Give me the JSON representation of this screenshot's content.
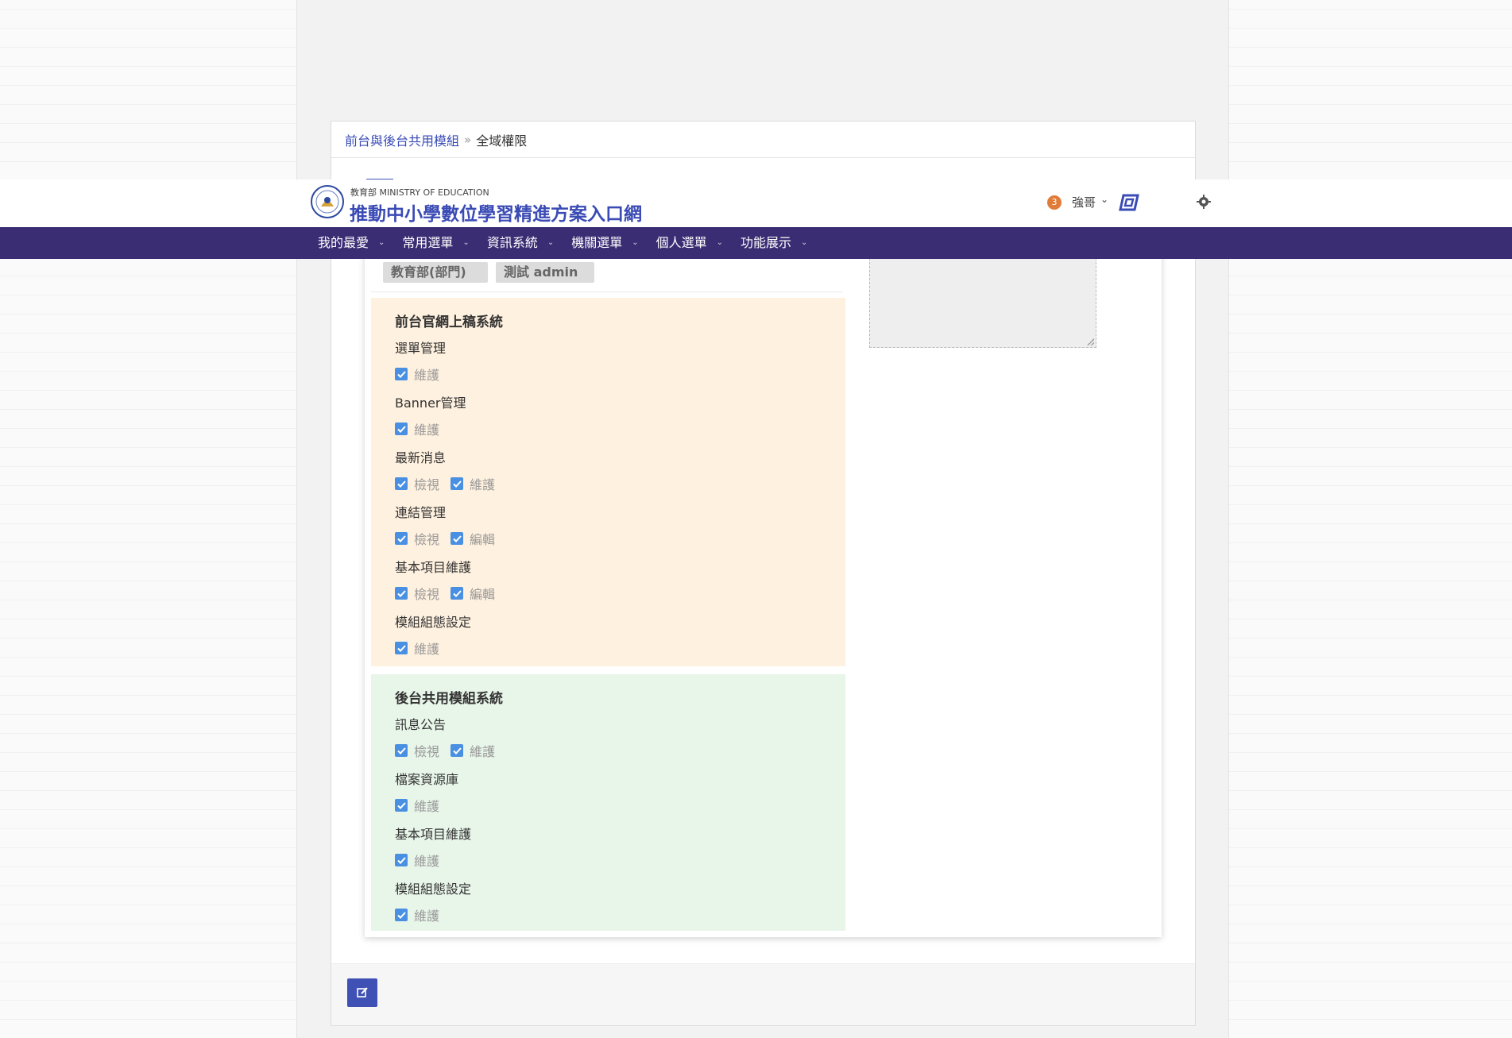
{
  "header": {
    "ministry_label": "教育部 MINISTRY OF EDUCATION",
    "site_title": "推動中小學數位學習精進方案入口網",
    "notification_count": "3",
    "user_name": "強哥"
  },
  "nav": {
    "items": [
      {
        "label": "我的最愛"
      },
      {
        "label": "常用選單"
      },
      {
        "label": "資訊系統"
      },
      {
        "label": "機關選單"
      },
      {
        "label": "個人選單"
      },
      {
        "label": "功能展示"
      }
    ]
  },
  "breadcrumb": {
    "parent": "前台與後台共用模組",
    "separator": "»",
    "current": "全域權限"
  },
  "tags": [
    "教育部(部門)",
    "測試 admin"
  ],
  "sections": [
    {
      "title": "前台官網上稿系統",
      "color": "#fff1df",
      "modules": [
        {
          "name": "選單管理",
          "perms": [
            "維護"
          ]
        },
        {
          "name": "Banner管理",
          "perms": [
            "維護"
          ]
        },
        {
          "name": "最新消息",
          "perms": [
            "檢視",
            "維護"
          ]
        },
        {
          "name": "連結管理",
          "perms": [
            "檢視",
            "編輯"
          ]
        },
        {
          "name": "基本項目維護",
          "perms": [
            "檢視",
            "編輯"
          ]
        },
        {
          "name": "模組組態設定",
          "perms": [
            "維護"
          ]
        }
      ]
    },
    {
      "title": "後台共用模組系統",
      "color": "#e8f5e9",
      "modules": [
        {
          "name": "訊息公告",
          "perms": [
            "檢視",
            "維護"
          ]
        },
        {
          "name": "檔案資源庫",
          "perms": [
            "維護"
          ]
        },
        {
          "name": "基本項目維護",
          "perms": [
            "維護"
          ]
        },
        {
          "name": "模組組態設定",
          "perms": [
            "維護"
          ]
        }
      ]
    }
  ],
  "colors": {
    "brand": "#3a4bb5",
    "nav_bg": "#3b2d73",
    "checkbox": "#4a90e2",
    "badge": "#e07b39"
  },
  "icons": {
    "edit": "edit-icon",
    "gear": "gear-icon",
    "caret": "chevron-down-icon"
  }
}
